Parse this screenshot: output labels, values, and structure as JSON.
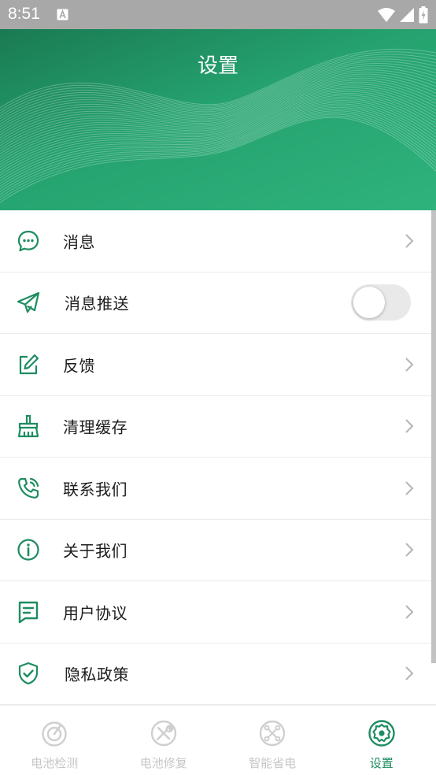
{
  "status_bar": {
    "time": "8:51"
  },
  "header": {
    "title": "设置"
  },
  "settings": [
    {
      "label": "消息",
      "icon": "message-icon",
      "control": "chevron"
    },
    {
      "label": "消息推送",
      "icon": "send-icon",
      "control": "toggle",
      "toggle_on": false
    },
    {
      "label": "反馈",
      "icon": "edit-icon",
      "control": "chevron"
    },
    {
      "label": "清理缓存",
      "icon": "broom-icon",
      "control": "chevron"
    },
    {
      "label": "联系我们",
      "icon": "phone-icon",
      "control": "chevron"
    },
    {
      "label": "关于我们",
      "icon": "info-icon",
      "control": "chevron"
    },
    {
      "label": "用户协议",
      "icon": "document-icon",
      "control": "chevron"
    },
    {
      "label": "隐私政策",
      "icon": "shield-icon",
      "control": "chevron"
    }
  ],
  "bottom_nav": [
    {
      "label": "电池检测",
      "icon": "battery-detect-icon",
      "active": false
    },
    {
      "label": "电池修复",
      "icon": "battery-repair-icon",
      "active": false
    },
    {
      "label": "智能省电",
      "icon": "smart-save-icon",
      "active": false
    },
    {
      "label": "设置",
      "icon": "settings-icon",
      "active": true
    }
  ],
  "colors": {
    "accent": "#1e8c60",
    "header_start": "#1a7a52",
    "header_end": "#2fb37d",
    "inactive": "#c6c6c6"
  }
}
